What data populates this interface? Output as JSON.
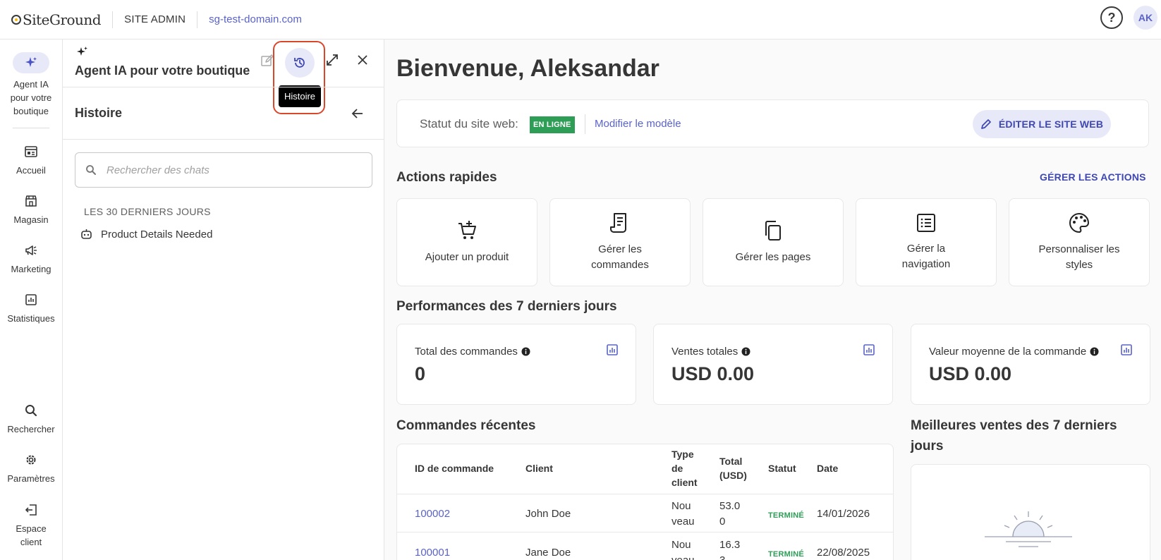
{
  "topbar": {
    "logo_text": "SiteGround",
    "site_admin": "SITE ADMIN",
    "domain": "sg-test-domain.com",
    "help_label": "?",
    "avatar_initials": "AK"
  },
  "rail": {
    "items": [
      {
        "label": "Agent IA pour votre boutique",
        "icon": "sparkle-icon"
      },
      {
        "label": "Accueil",
        "icon": "dashboard-icon"
      },
      {
        "label": "Magasin",
        "icon": "store-icon"
      },
      {
        "label": "Marketing",
        "icon": "megaphone-icon"
      },
      {
        "label": "Statistiques",
        "icon": "stats-icon"
      },
      {
        "label": "Rechercher",
        "icon": "search-icon"
      },
      {
        "label": "Paramètres",
        "icon": "gear-icon"
      },
      {
        "label": "Espace client",
        "icon": "logout-icon"
      }
    ]
  },
  "ai_panel": {
    "title": "Agent IA pour votre boutique",
    "tooltip": "Histoire",
    "history_title": "Histoire",
    "search_placeholder": "Rechercher des chats",
    "section_label": "LES 30 DERNIERS JOURS",
    "chats": [
      {
        "title": "Product Details Needed"
      }
    ]
  },
  "main": {
    "welcome": "Bienvenue, Aleksandar",
    "status": {
      "label": "Statut du site web:",
      "badge": "EN LIGNE",
      "modify_link": "Modifier le modèle",
      "edit_button": "ÉDITER LE SITE WEB"
    },
    "quick_actions": {
      "title": "Actions rapides",
      "manage_link": "GÉRER LES ACTIONS",
      "items": [
        {
          "label": "Ajouter un produit",
          "icon": "cart-add-icon"
        },
        {
          "label": "Gérer les commandes",
          "icon": "receipt-icon"
        },
        {
          "label": "Gérer les pages",
          "icon": "pages-icon"
        },
        {
          "label": "Gérer la navigation",
          "icon": "list-icon"
        },
        {
          "label": "Personnaliser les styles",
          "icon": "palette-icon"
        }
      ]
    },
    "performance": {
      "title": "Performances des 7 derniers jours",
      "cards": [
        {
          "label": "Total des commandes",
          "value": "0"
        },
        {
          "label": "Ventes totales",
          "value": "USD 0.00"
        },
        {
          "label": "Valeur moyenne de la commande",
          "value": "USD 0.00"
        }
      ]
    },
    "recent_orders": {
      "title": "Commandes récentes",
      "headers": [
        "ID de commande",
        "Client",
        "Type de client",
        "Total (USD)",
        "Statut",
        "Date"
      ],
      "rows": [
        {
          "id": "100002",
          "client": "John Doe",
          "type": "Nou veau",
          "total": "53.0 0",
          "status": "TERMINÉ",
          "date": "14/01/2026"
        },
        {
          "id": "100001",
          "client": "Jane Doe",
          "type": "Nou veau",
          "total": "16.3 3",
          "status": "TERMINÉ",
          "date": "22/08/2025"
        }
      ]
    },
    "best_sellers": {
      "title": "Meilleures ventes des 7 derniers jours"
    }
  },
  "colors": {
    "accent": "#5a63c9",
    "accent_dark": "#3e47b2",
    "accent_light": "#e8e9f8",
    "online": "#2e9e57",
    "highlight_ring": "#d9472b"
  }
}
